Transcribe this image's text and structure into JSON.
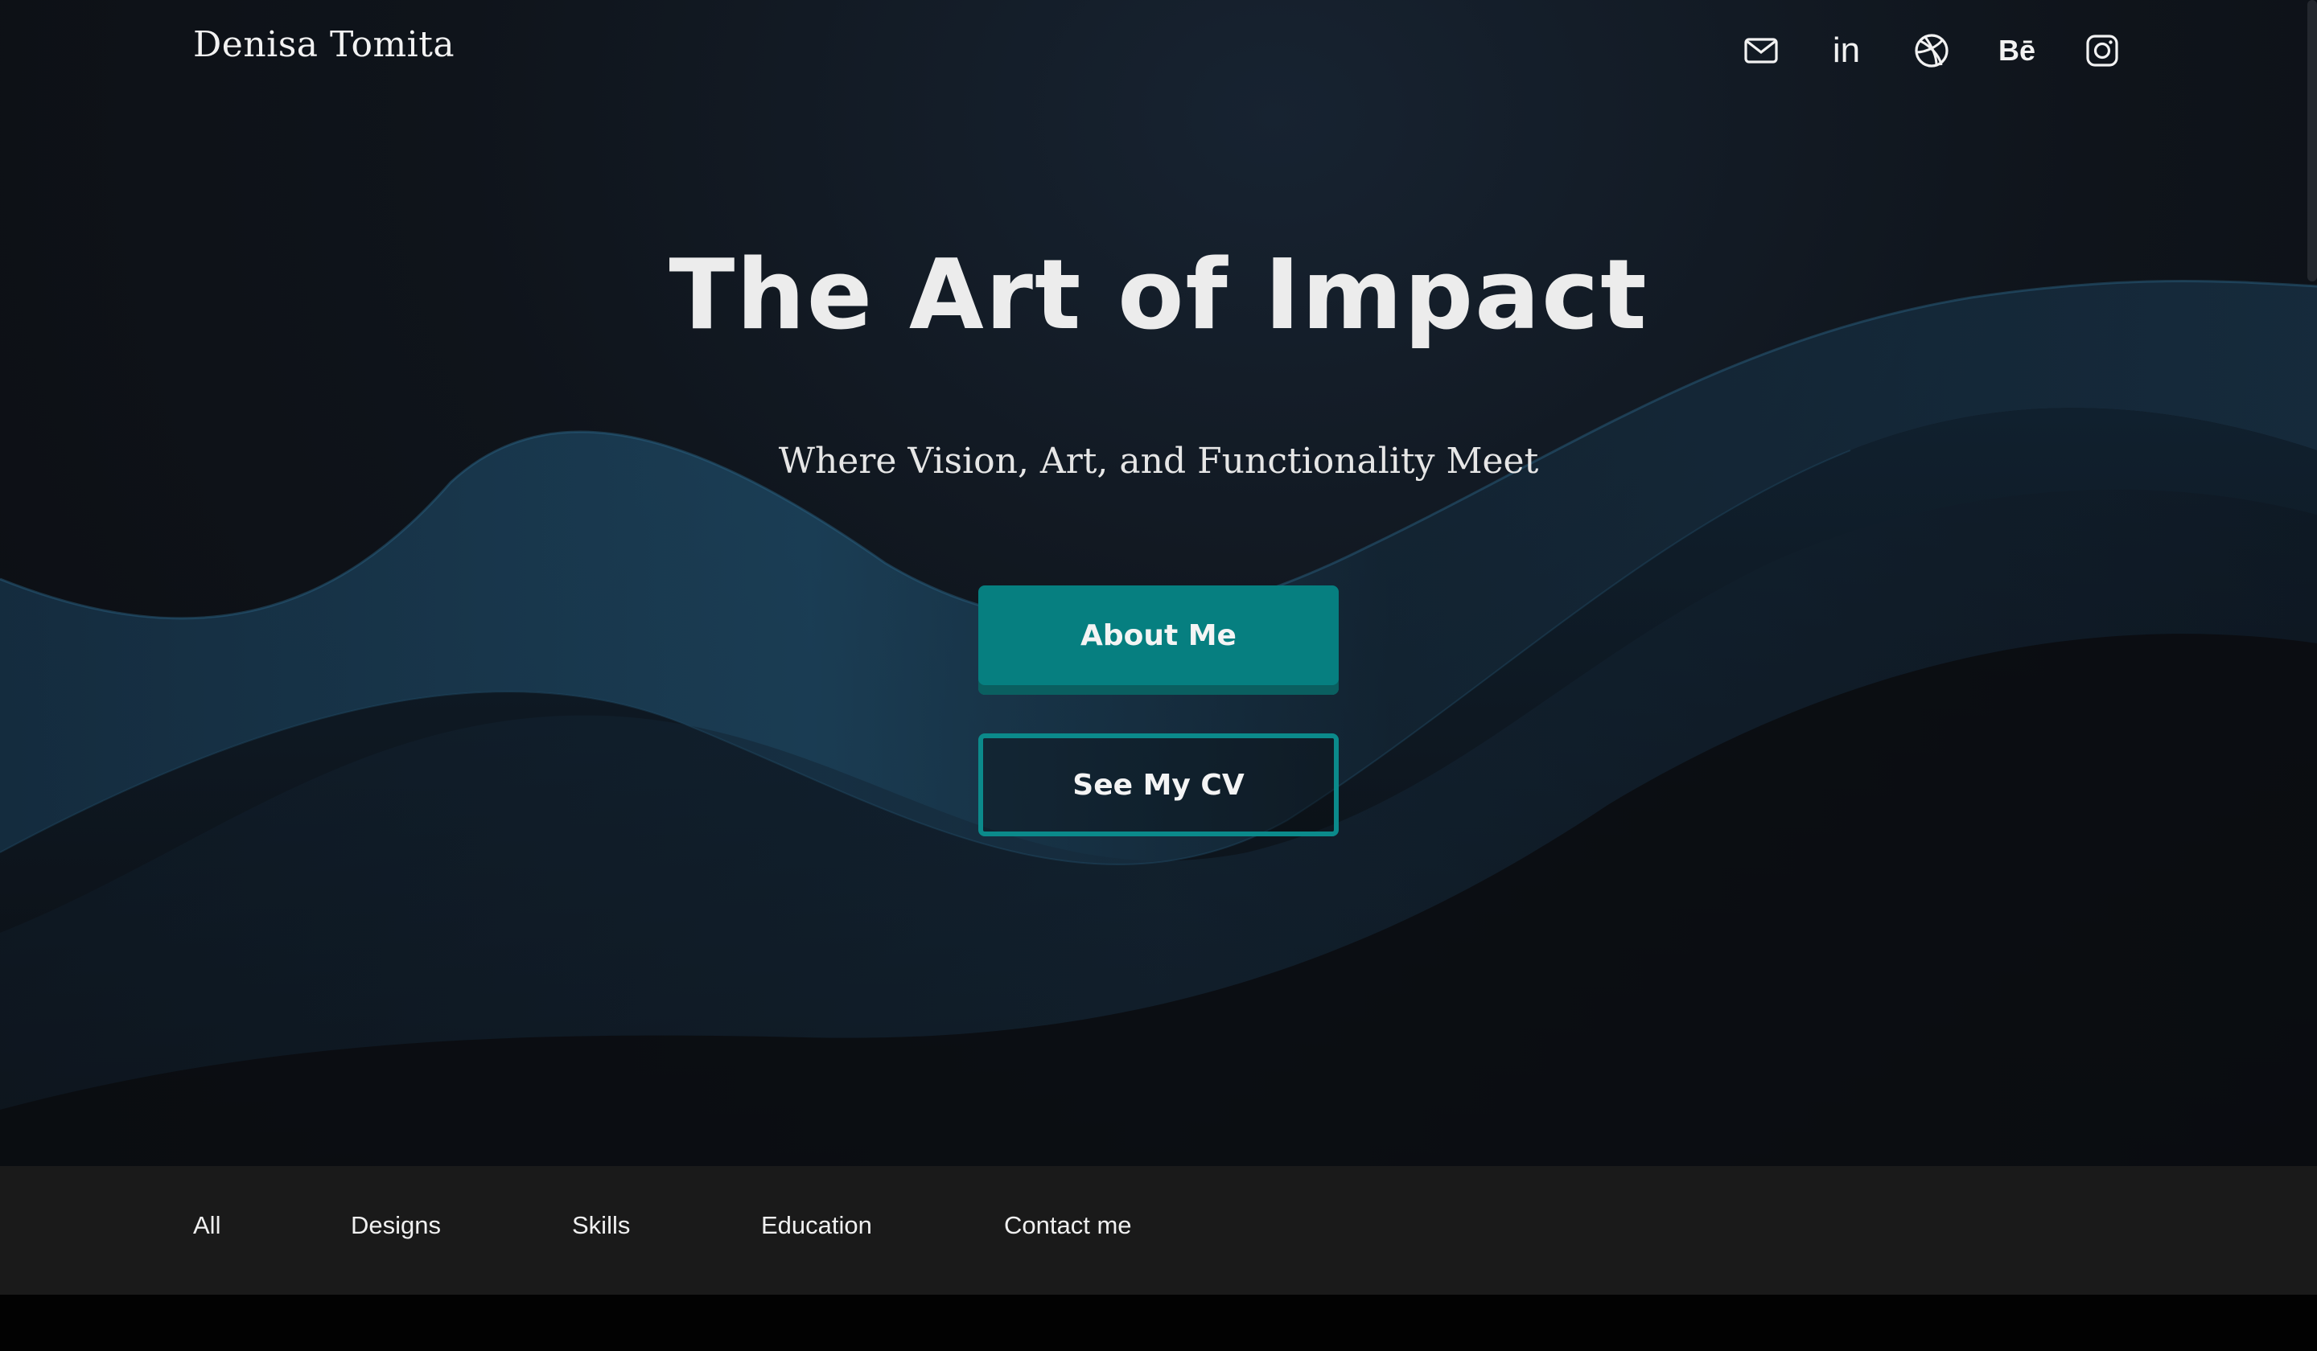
{
  "brand": "Denisa Tomita",
  "social_icons": [
    "mail-icon",
    "linkedin-icon",
    "dribbble-icon",
    "behance-icon",
    "instagram-icon"
  ],
  "linkedin_label": "in",
  "behance_label": "Bē",
  "hero": {
    "title": "The Art of Impact",
    "subtitle": "Where Vision, Art, and Functionality Meet",
    "primary_button": "About Me",
    "secondary_button": "See My CV"
  },
  "nav": {
    "items": [
      "All",
      "Designs",
      "Skills",
      "Education",
      "Contact me"
    ]
  },
  "colors": {
    "accent": "#067f80",
    "accent_border": "#0b8a8b",
    "background": "#0b0d11",
    "navbar": "#1a1a1a"
  }
}
